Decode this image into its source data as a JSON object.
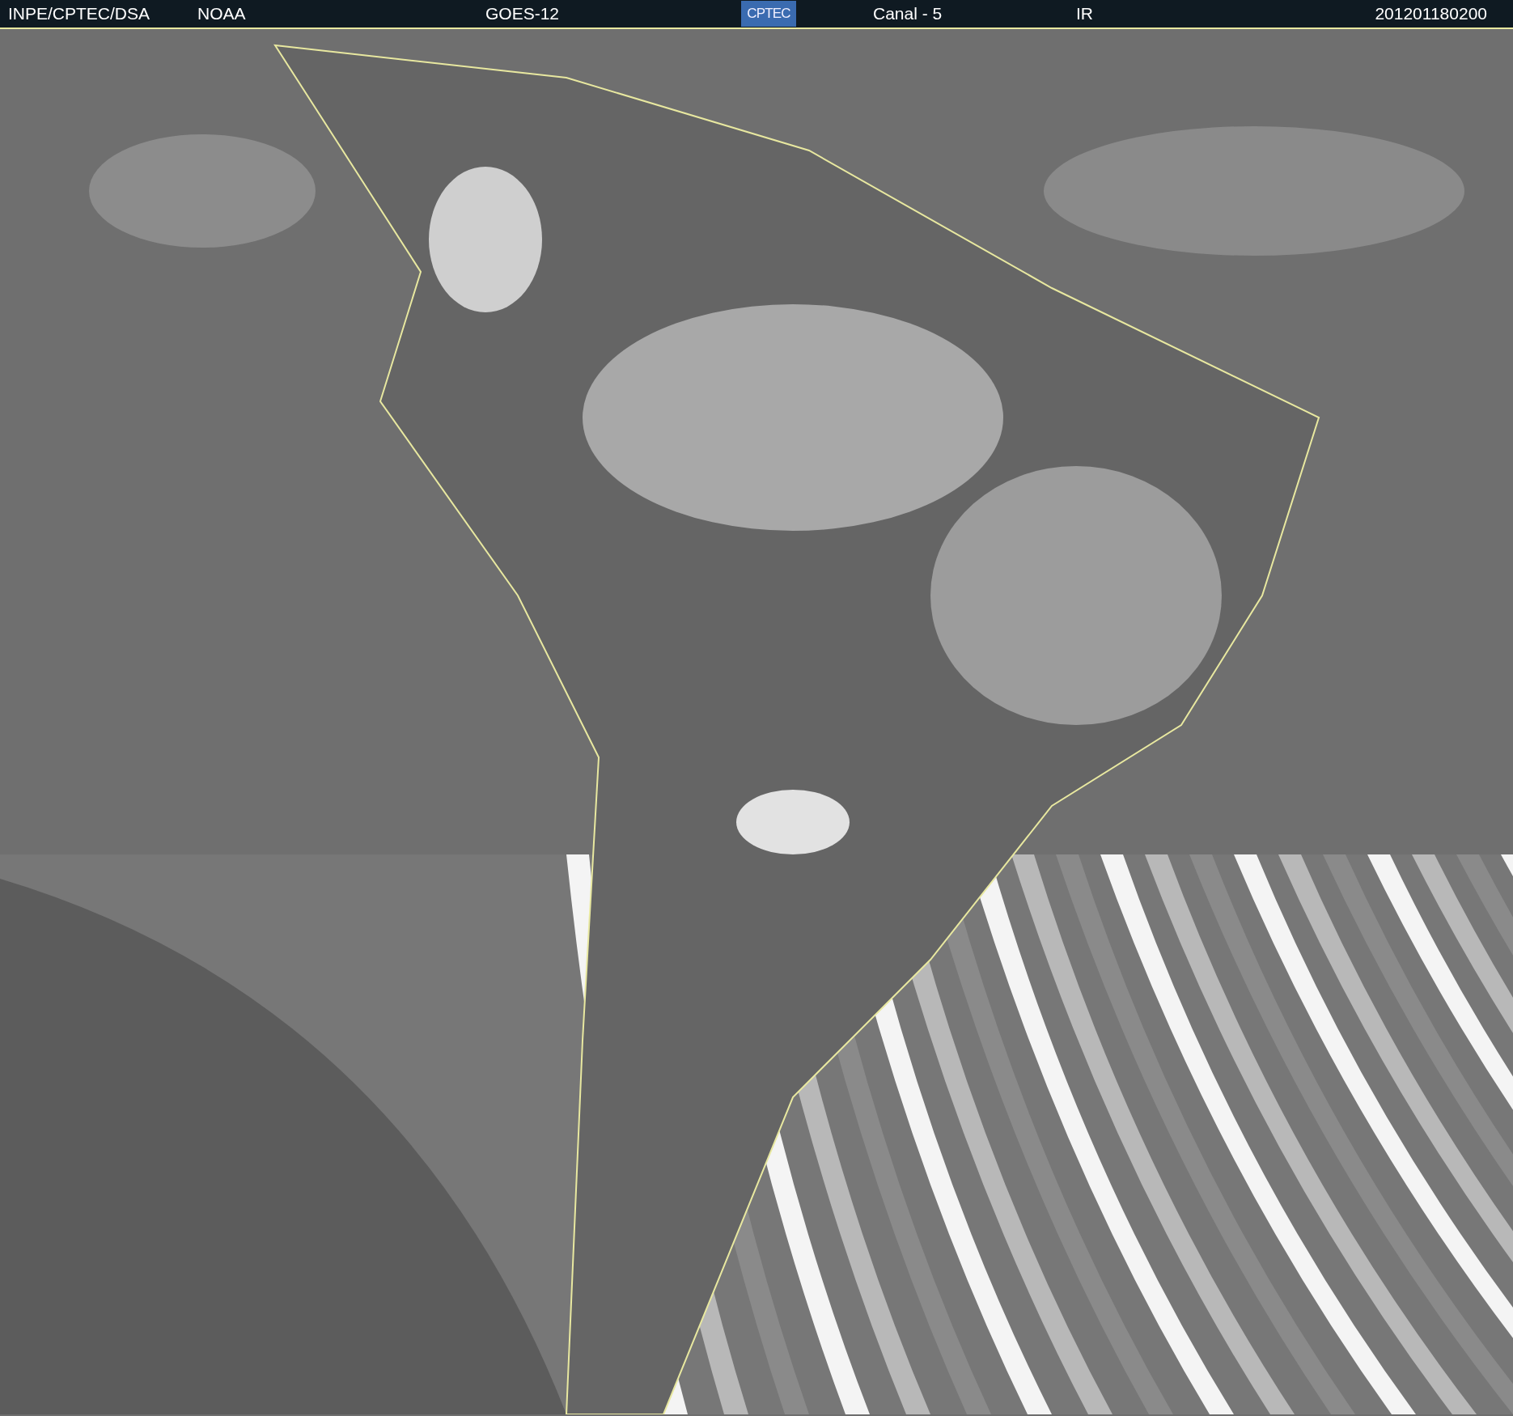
{
  "header": {
    "source": "INPE/CPTEC/DSA",
    "agency": "NOAA",
    "satellite": "GOES-12",
    "logo": "CPTEC",
    "channel": "Canal - 5",
    "band": "IR",
    "timestamp": "201201180200"
  }
}
